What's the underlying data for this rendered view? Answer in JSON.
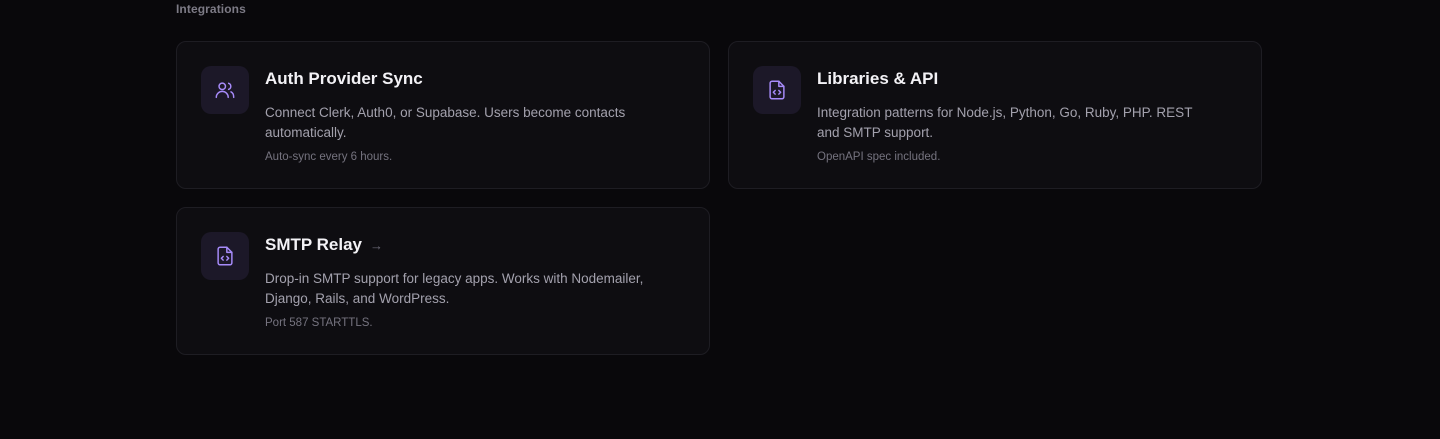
{
  "section": {
    "title": "Integrations"
  },
  "cards": [
    {
      "title": "Auth Provider Sync",
      "description": "Connect Clerk, Auth0, or Supabase. Users become contacts automatically.",
      "note": "Auto-sync every 6 hours.",
      "icon": "users-icon"
    },
    {
      "title": "Libraries & API",
      "description": "Integration patterns for Node.js, Python, Go, Ruby, PHP. REST and SMTP support.",
      "note": "OpenAPI spec included.",
      "icon": "file-code-icon"
    },
    {
      "title": "SMTP Relay",
      "description": "Drop-in SMTP support for legacy apps. Works with Nodemailer, Django, Rails, and WordPress.",
      "note": "Port 587 STARTTLS.",
      "icon": "file-code-icon",
      "arrow": "→"
    }
  ],
  "colors": {
    "background": "#09080b",
    "card": "#0e0d11",
    "icon_accent": "#a78bfa",
    "icon_bg": "#1c1828"
  }
}
